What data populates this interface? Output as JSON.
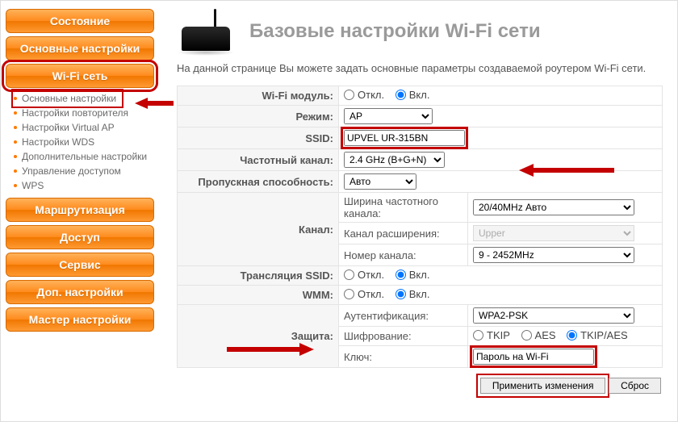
{
  "sidebar": {
    "items": [
      {
        "label": "Состояние"
      },
      {
        "label": "Основные настройки"
      },
      {
        "label": "Wi-Fi сеть",
        "framed": true
      },
      {
        "label": "Маршрутизация"
      },
      {
        "label": "Доступ"
      },
      {
        "label": "Сервис"
      },
      {
        "label": "Доп. настройки"
      },
      {
        "label": "Мастер настройки"
      }
    ],
    "wifi_sub": [
      {
        "label": "Основные настройки",
        "framed": true
      },
      {
        "label": "Настройки повторителя"
      },
      {
        "label": "Настройки Virtual AP"
      },
      {
        "label": "Настройки WDS"
      },
      {
        "label": "Дополнительные настройки"
      },
      {
        "label": "Управление доступом"
      },
      {
        "label": "WPS"
      }
    ]
  },
  "page": {
    "title": "Базовые настройки Wi-Fi сети",
    "description": "На данной странице Вы можете задать основные параметры создаваемой роутером Wi-Fi сети."
  },
  "form": {
    "wifi_module_label": "Wi-Fi модуль:",
    "mode_label": "Режим:",
    "ssid_label": "SSID:",
    "band_label": "Частотный канал:",
    "bandwidth_label": "Пропускная способность:",
    "channel_label": "Канал:",
    "channel_width_label": "Ширина частотного канала:",
    "ext_channel_label": "Канал расширения:",
    "channel_num_label": "Номер канала:",
    "ssid_bcast_label": "Трансляция SSID:",
    "wmm_label": "WMM:",
    "security_label": "Защита:",
    "auth_label": "Аутентификация:",
    "enc_label": "Шифрование:",
    "key_label": "Ключ:",
    "off_label": "Откл.",
    "on_label": "Вкл.",
    "tkip_label": "TKIP",
    "aes_label": "AES",
    "tkipaes_label": "TKIP/AES",
    "mode_value": "AP",
    "ssid_value": "UPVEL UR-315BN",
    "band_value": "2.4 GHz (B+G+N)",
    "bw_value": "Авто",
    "chwidth_value": "20/40MHz Авто",
    "extch_value": "Upper",
    "chnum_value": "9 - 2452MHz",
    "auth_value": "WPA2-PSK",
    "key_value": "Пароль на Wi-Fi"
  },
  "buttons": {
    "apply": "Применить изменения",
    "reset": "Сброс"
  }
}
